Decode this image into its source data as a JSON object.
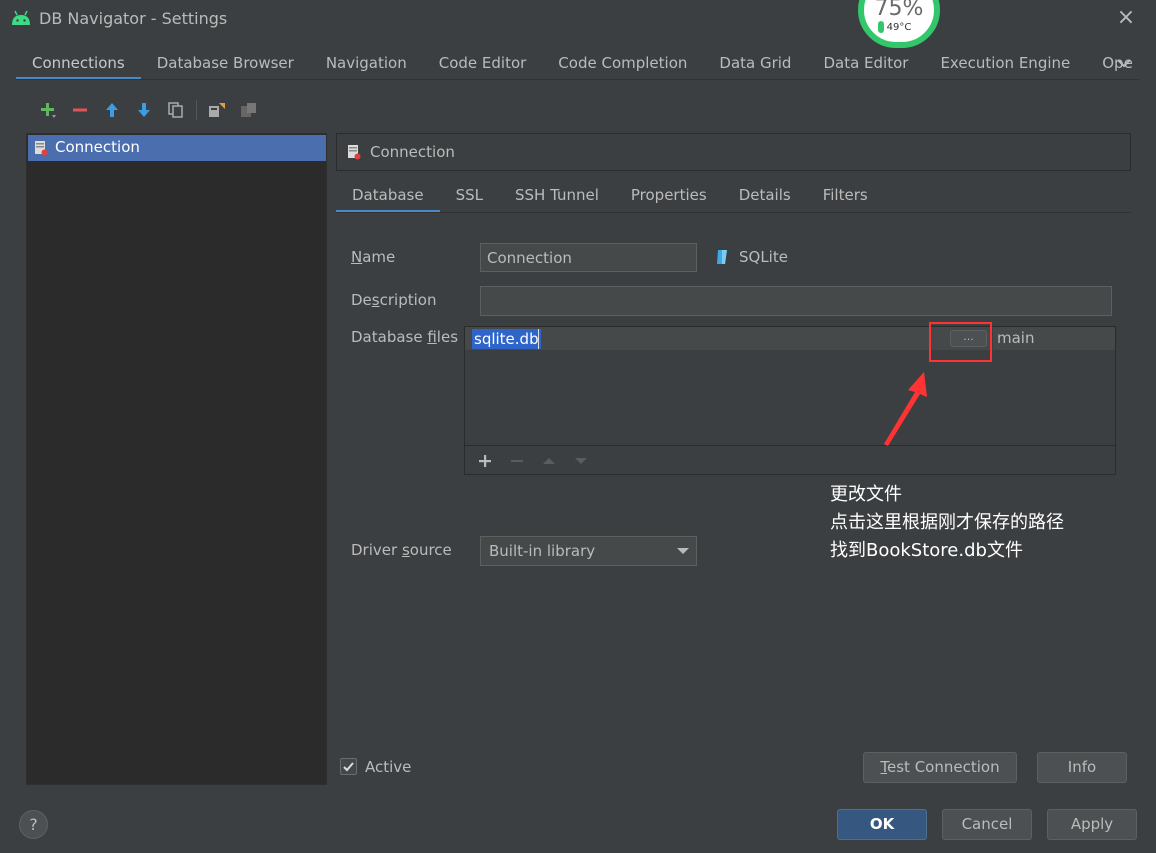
{
  "window": {
    "title": "DB Navigator - Settings",
    "close_icon": "×"
  },
  "monitor": {
    "percent": "75%",
    "temperature": "49°C",
    "accent": "#31c76a"
  },
  "top_tabs": [
    {
      "label": "Connections",
      "active": true
    },
    {
      "label": "Database Browser"
    },
    {
      "label": "Navigation"
    },
    {
      "label": "Code Editor"
    },
    {
      "label": "Code Completion"
    },
    {
      "label": "Data Grid"
    },
    {
      "label": "Data Editor"
    },
    {
      "label": "Execution Engine"
    },
    {
      "label": "Ope"
    }
  ],
  "toolbar": {
    "icons": [
      "add-icon",
      "remove-icon",
      "move-up-icon",
      "move-down-icon",
      "copy-icon",
      "export-icon",
      "import-icon"
    ]
  },
  "connections": [
    {
      "label": "Connection",
      "selected": true
    }
  ],
  "detail": {
    "header_title": "Connection",
    "sub_tabs": [
      {
        "label": "Database",
        "active": true
      },
      {
        "label": "SSL"
      },
      {
        "label": "SSH Tunnel"
      },
      {
        "label": "Properties"
      },
      {
        "label": "Details"
      },
      {
        "label": "Filters"
      }
    ],
    "name_label_u": "N",
    "name_label_rest": "ame",
    "name_value": "Connection",
    "db_type": "SQLite",
    "desc_label_pre": "De",
    "desc_label_u": "s",
    "desc_label_rest": "cription",
    "desc_value": "",
    "dbfiles_label_pre": "Database ",
    "dbfiles_label_u": "f",
    "dbfiles_label_rest": "iles",
    "db_files": [
      {
        "path": "sqlite.db",
        "schema": "main"
      }
    ],
    "browse_label": "...",
    "driver_label_pre": "Driver ",
    "driver_label_u": "s",
    "driver_label_rest": "ource",
    "driver_value": "Built-in library",
    "active_label": "Active",
    "active_checked": true,
    "check_mark": "✓"
  },
  "annotation": {
    "lines": [
      "更改文件",
      "点击这里根据刚才保存的路径",
      "找到BookStore.db文件"
    ],
    "color": "#ff3333"
  },
  "buttons": {
    "test_u": "T",
    "test_rest": "est Connection",
    "info": "Info",
    "ok": "OK",
    "cancel": "Cancel",
    "apply": "Apply",
    "help": "?"
  }
}
